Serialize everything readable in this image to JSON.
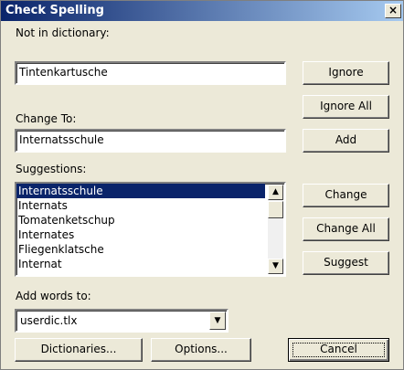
{
  "window": {
    "title": "Check Spelling",
    "close_glyph": "×"
  },
  "not_in_dictionary": {
    "label": "Not in dictionary:",
    "value": "Tintenkartusche"
  },
  "change_to": {
    "label": "Change To:",
    "value": "Internatsschule"
  },
  "suggestions": {
    "label": "Suggestions:",
    "items": [
      "Internatsschule",
      "Internats",
      "Tomatenketschup",
      "Internates",
      "Fliegenklatsche",
      "Internat"
    ],
    "selected_index": 0
  },
  "add_words_to": {
    "label": "Add words to:",
    "value": "userdic.tlx"
  },
  "buttons": {
    "ignore": "Ignore",
    "ignore_all": "Ignore All",
    "add": "Add",
    "change": "Change",
    "change_all": "Change All",
    "suggest": "Suggest",
    "dictionaries": "Dictionaries...",
    "options": "Options...",
    "cancel": "Cancel"
  },
  "icons": {
    "scroll_up": "▲",
    "scroll_down": "▼",
    "dropdown": "▼"
  }
}
